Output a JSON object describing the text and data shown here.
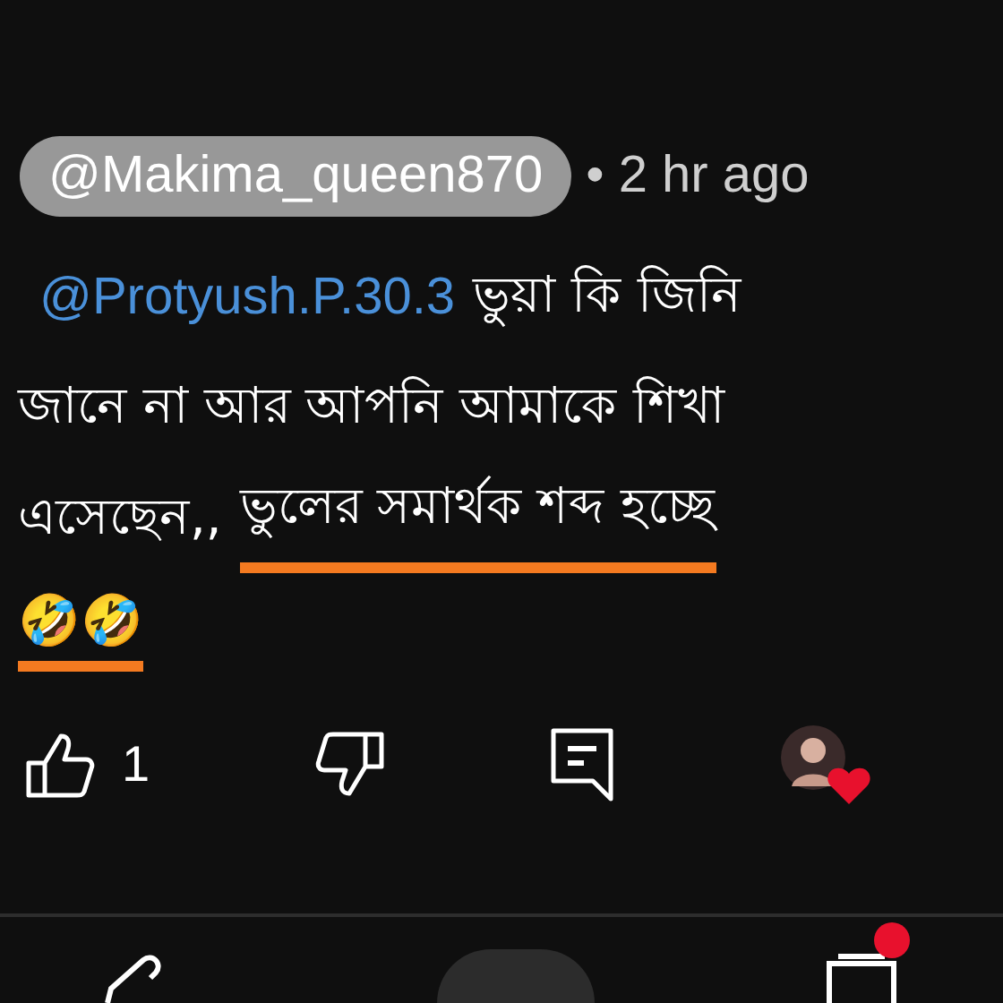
{
  "comment": {
    "author": "@Makima_queen870",
    "time": "• 2 hr ago",
    "lines": [
      [
        {
          "kind": "mention",
          "text": "@Protyush.P.30.3",
          "underlined": false
        },
        {
          "kind": "text",
          "text": "ভুয়া কি জিনি",
          "underlined": false
        }
      ],
      [
        {
          "kind": "text",
          "text": "জানে না আর আপনি আমাকে শিখা",
          "underlined": false
        }
      ],
      [
        {
          "kind": "text",
          "text": "এসেছেন,,",
          "underlined": false
        },
        {
          "kind": "text",
          "text": "ভুলের সমার্থক শব্দ হচ্ছে",
          "underlined": true
        }
      ],
      [
        {
          "kind": "text",
          "text": "🤣🤣",
          "underlined": true
        }
      ]
    ],
    "likes": "1",
    "creator_hearted": true
  }
}
